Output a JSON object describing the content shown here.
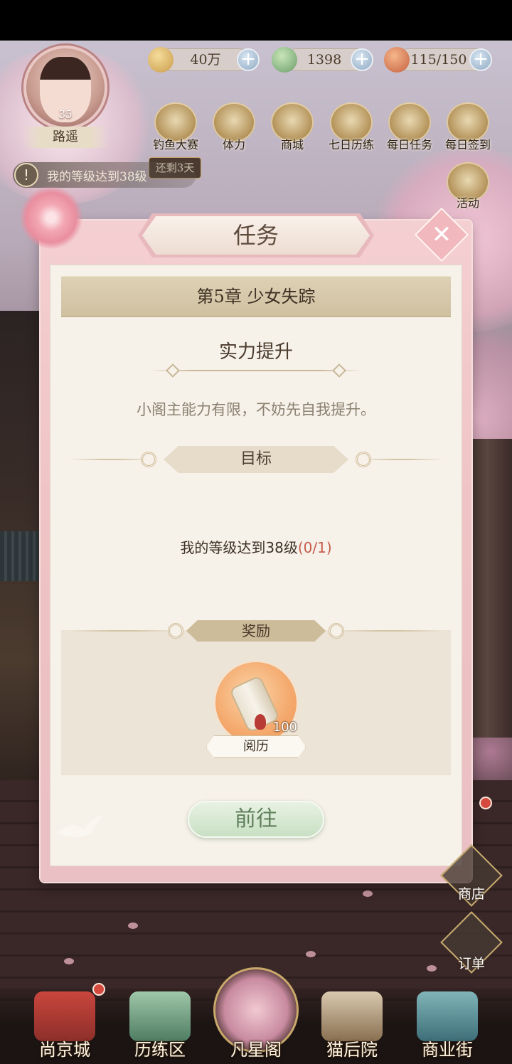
{
  "player": {
    "level": "35",
    "name": "路遥"
  },
  "resources": [
    {
      "icon": "paw-coin-icon",
      "value": "40万"
    },
    {
      "icon": "jade-icon",
      "value": "1398"
    },
    {
      "icon": "food-basket-icon",
      "value": "115/150"
    }
  ],
  "top_menu": [
    {
      "label": "钓鱼大赛",
      "icon": "fishing-icon",
      "badge": "还剩3天"
    },
    {
      "label": "体力",
      "icon": "stamina-icon"
    },
    {
      "label": "商城",
      "icon": "mall-icon"
    },
    {
      "label": "七日历练",
      "icon": "seven-day-icon"
    },
    {
      "label": "每日任务",
      "icon": "daily-task-icon"
    },
    {
      "label": "每日签到",
      "icon": "daily-checkin-icon"
    }
  ],
  "activity": {
    "label": "活动",
    "icon": "treasure-chest-icon"
  },
  "notice": {
    "text": "我的等级达到38级"
  },
  "dialog": {
    "title": "任务",
    "chapter": "第5章 少女失踪",
    "task_name": "实力提升",
    "description": "小阁主能力有限，不妨先自我提升。",
    "goal_header": "目标",
    "goal_text": "我的等级达到38级",
    "goal_progress": "(0/1)",
    "reward_header": "奖励",
    "reward": {
      "name": "阅历",
      "count": "100",
      "icon": "scroll-icon"
    },
    "go_button": "前往"
  },
  "side_buttons": [
    {
      "label": "商店",
      "icon": "shop-icon"
    },
    {
      "label": "订单",
      "icon": "order-icon"
    }
  ],
  "bottom_nav": [
    {
      "label": "尚京城",
      "icon": "city-gate-icon",
      "alert": true
    },
    {
      "label": "历练区",
      "icon": "mountain-icon"
    },
    {
      "label": "凡星阁",
      "icon": "cherry-tree-icon",
      "active": true
    },
    {
      "label": "猫后院",
      "icon": "cat-icon"
    },
    {
      "label": "商业街",
      "icon": "market-gate-icon"
    }
  ],
  "colors": {
    "dialog_pink": "#efc2c4",
    "paper": "#f6f1e9",
    "go_green": "#c8e0c4",
    "progress_red": "#c65d4e"
  }
}
